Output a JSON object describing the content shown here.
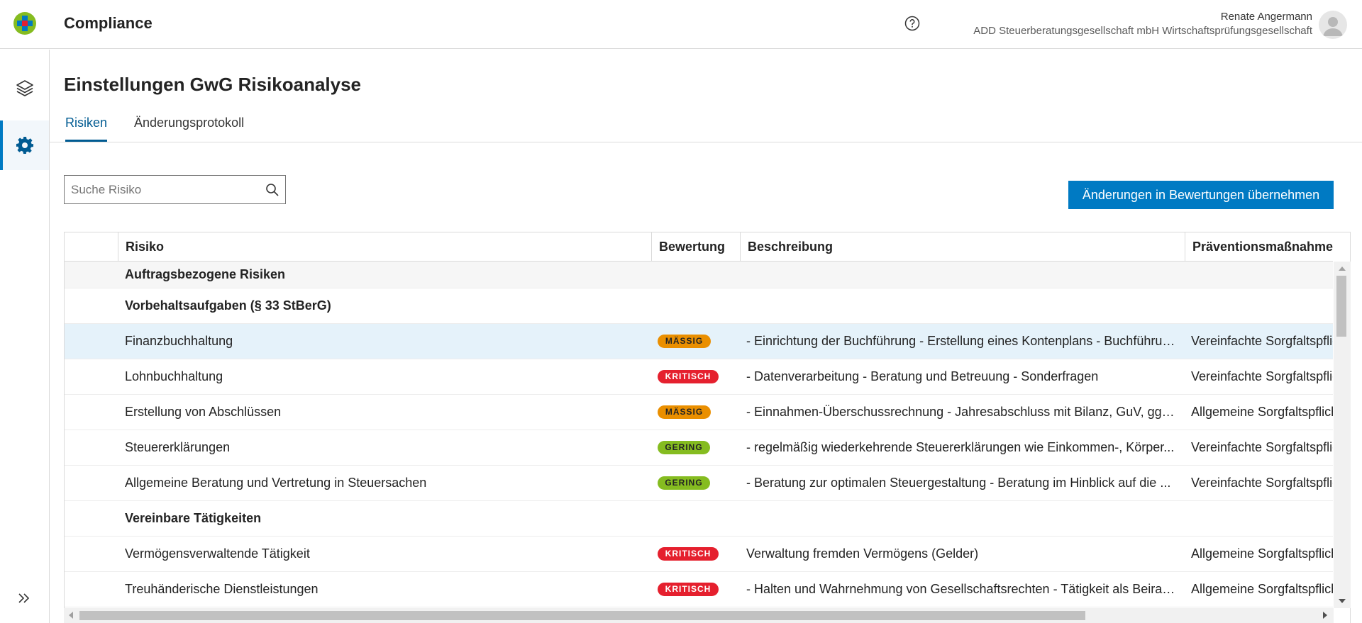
{
  "header": {
    "app_title": "Compliance",
    "user_name": "Renate Angermann",
    "user_org": "ADD Steuerberatungsgesellschaft mbH Wirtschaftsprüfungsgesellschaft"
  },
  "page": {
    "title": "Einstellungen GwG Risikoanalyse",
    "tabs": [
      {
        "label": "Risiken",
        "active": true
      },
      {
        "label": "Änderungsprotokoll",
        "active": false
      }
    ]
  },
  "search": {
    "placeholder": "Suche Risiko",
    "value": ""
  },
  "actions": {
    "apply_button": "Änderungen in Bewertungen übernehmen"
  },
  "table": {
    "columns": [
      "Risiko",
      "Bewertung",
      "Beschreibung",
      "Präventionsmaßnahmen"
    ],
    "groups": {
      "g1": "Auftragsbezogene Risiken",
      "g2": "Vorbehaltsaufgaben (§ 33 StBerG)",
      "g3": "Vereinbare Tätigkeiten"
    },
    "rows": [
      {
        "risk": "Finanzbuchhaltung",
        "rating": "MÄSSIG",
        "desc": "- Einrichtung der Buchführung - Erstellung eines Kontenplans - Buchführung ...",
        "prevention": "Vereinfachte Sorgfaltspflichten"
      },
      {
        "risk": "Lohnbuchhaltung",
        "rating": "KRITISCH",
        "desc": "- Datenverarbeitung - Beratung und Betreuung - Sonderfragen",
        "prevention": "Vereinfachte Sorgfaltspflichten"
      },
      {
        "risk": "Erstellung von Abschlüssen",
        "rating": "MÄSSIG",
        "desc": "- Einnahmen-Überschussrechnung - Jahresabschluss mit Bilanz, GuV, ggf. ...",
        "prevention": "Allgemeine Sorgfaltspflichten"
      },
      {
        "risk": "Steuererklärungen",
        "rating": "GERING",
        "desc": "- regelmäßig wiederkehrende Steuererklärungen wie Einkommen-, Körper...",
        "prevention": "Vereinfachte Sorgfaltspflichten"
      },
      {
        "risk": "Allgemeine Beratung und Vertretung in Steuersachen",
        "rating": "GERING",
        "desc": "- Beratung zur optimalen Steuergestaltung - Beratung im Hinblick auf die ...",
        "prevention": "Vereinfachte Sorgfaltspflichten"
      },
      {
        "risk": "Vermögensverwaltende Tätigkeit",
        "rating": "KRITISCH",
        "desc": "Verwaltung fremden Vermögens (Gelder)",
        "prevention": "Allgemeine Sorgfaltspflichten"
      },
      {
        "risk": "Treuhänderische Dienstleistungen",
        "rating": "KRITISCH",
        "desc": "- Halten und Wahrnehmung von Gesellschaftsrechten - Tätigkeit als Beirat ...",
        "prevention": "Allgemeine Sorgfaltspflichten"
      }
    ]
  },
  "icons": {
    "logo": "wolters-kluwer-logo",
    "help": "help-circle-icon",
    "layers": "layers-icon",
    "settings": "gear-icon",
    "expand": "double-chevron-right-icon",
    "search": "search-icon"
  },
  "colors": {
    "primary": "#007ac3",
    "selected_row": "#e5f2fa",
    "massig": "#ea8f00",
    "kritisch": "#e5202e",
    "gering": "#85bc20"
  }
}
